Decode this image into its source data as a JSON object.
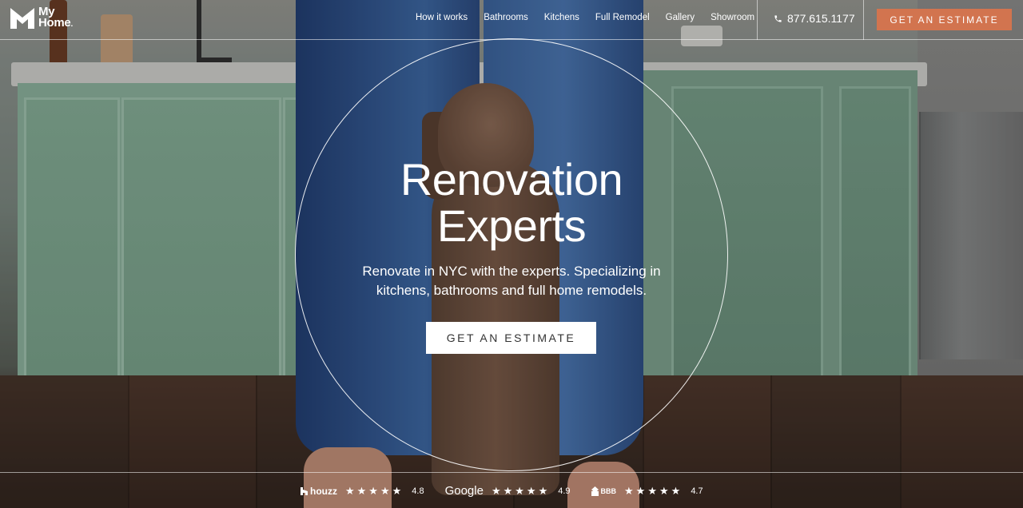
{
  "brand": {
    "name_line1": "My",
    "name_line2": "Home"
  },
  "nav": {
    "items": [
      {
        "label": "How it works"
      },
      {
        "label": "Bathrooms"
      },
      {
        "label": "Kitchens"
      },
      {
        "label": "Full Remodel"
      },
      {
        "label": "Gallery"
      },
      {
        "label": "Showroom"
      }
    ]
  },
  "header": {
    "phone": "877.615.1177",
    "phone_icon": "phone-icon",
    "cta_label": "GET AN ESTIMATE",
    "cta_color": "#d2744f"
  },
  "hero": {
    "title_line1": "Renovation",
    "title_line2": "Experts",
    "subtitle": "Renovate in NYC with the experts. Specializing in kitchens, bathrooms and full home remodels.",
    "cta_label": "GET AN ESTIMATE"
  },
  "ratings": [
    {
      "brand": "houzz",
      "icon": "houzz-icon",
      "stars": "★★★★★",
      "score": "4.8"
    },
    {
      "brand": "Google",
      "icon": "google-icon",
      "stars": "★★★★★",
      "score": "4.9"
    },
    {
      "brand": "BBB",
      "icon": "bbb-icon",
      "stars": "★★★★★",
      "score": "4.7"
    }
  ]
}
